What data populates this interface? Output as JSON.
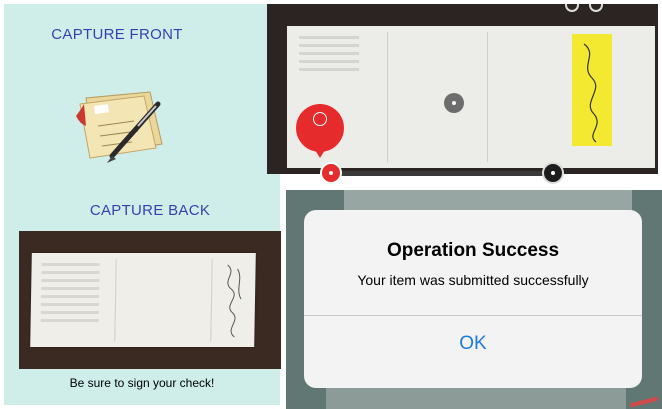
{
  "capture_front": {
    "title": "CAPTURE FRONT"
  },
  "capture_back": {
    "title": "CAPTURE BACK",
    "hint": "Be sure to sign your check!"
  },
  "camera": {
    "icons": [
      "check-pen-icon",
      "focus-dot-icon",
      "camera-badge-icon"
    ]
  },
  "dialog": {
    "title": "Operation Success",
    "message": "Your item was submitted successfully",
    "ok_label": "OK"
  },
  "colors": {
    "panel_bg": "#cfeeea",
    "title_blue": "#3a3fae",
    "accent_red": "#e52b2b",
    "ios_blue": "#1f7bd9"
  }
}
